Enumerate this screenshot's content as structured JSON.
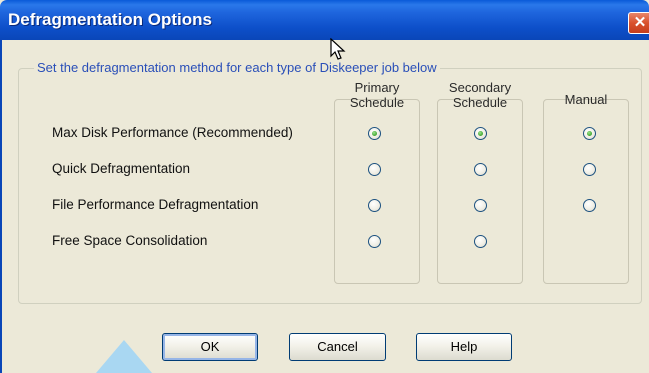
{
  "window": {
    "title": "Defragmentation Options",
    "close_glyph": "✕"
  },
  "group": {
    "legend": "Set the defragmentation method for each type of Diskeeper job below"
  },
  "columns": [
    {
      "line1": "Primary",
      "line2": "Schedule"
    },
    {
      "line1": "Secondary",
      "line2": "Schedule"
    },
    {
      "line1": "Manual",
      "line2": ""
    }
  ],
  "rows": [
    {
      "label": "Max Disk Performance (Recommended)",
      "options": [
        true,
        true,
        true
      ]
    },
    {
      "label": "Quick Defragmentation",
      "options": [
        false,
        false,
        false
      ]
    },
    {
      "label": "File Performance Defragmentation",
      "options": [
        false,
        false,
        false
      ]
    },
    {
      "label": "Free Space Consolidation",
      "options": [
        false,
        false,
        null
      ]
    }
  ],
  "buttons": {
    "ok": "OK",
    "cancel": "Cancel",
    "help": "Help"
  }
}
